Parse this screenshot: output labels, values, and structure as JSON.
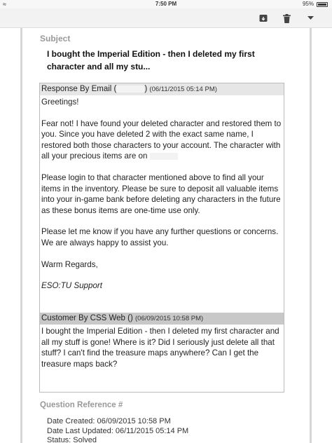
{
  "status_bar": {
    "time": "7:50 PM",
    "battery_percent": "95%"
  },
  "toolbar": {
    "icons": [
      "archive-icon",
      "trash-icon",
      "dropdown-icon"
    ]
  },
  "ticket": {
    "subject_label": "Subject",
    "subject": "I bought the Imperial Edition - then I deleted my first character and all my stu...",
    "messages": [
      {
        "sender_label": "Response By Email (",
        "sender_close": ")",
        "date": "(06/11/2015 05:14 PM)",
        "paragraphs": [
          "Greetings!",
          "Fear not! I have found your deleted character and restored them to you. Since you have deleted 2 with the exact same name, I restored both those characters to your account. The character with all your precious items are on",
          "Please login to that character mentioned above to find all your items in the inventory. Please be sure to deposit all valuable items into your in-game bank before deleting any characters in the future as these bonus items are one-time use only.",
          "Please let me know if you have any further questions or concerns. We are always happy to assist you.",
          "Warm Regards,"
        ],
        "signature": "ESO:TU Support"
      },
      {
        "sender_label": "Customer By CSS Web ()",
        "date": "(06/09/2015 10:58 PM)",
        "paragraphs": [
          "I bought the Imperial Edition - then I deleted my first character and all my stuff is gone! Where is it? Did I seriously just delete all that stuff? I can't find the treasure maps anywhere? Can I get the treasure maps back?"
        ]
      }
    ],
    "question_reference_label": "Question Reference #",
    "date_created": "Date Created: 06/09/2015 10:58 PM",
    "date_updated": "Date Last Updated: 06/11/2015 05:14 PM",
    "status": "Status: Solved"
  }
}
